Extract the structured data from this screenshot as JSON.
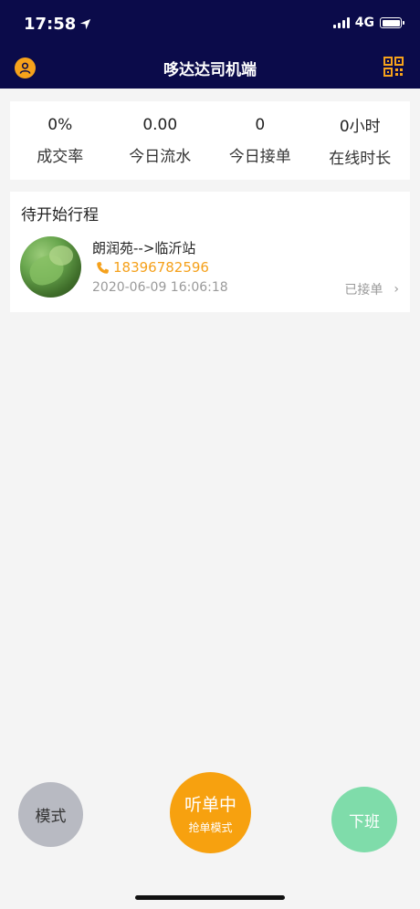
{
  "status_bar": {
    "time": "17:58",
    "network": "4G"
  },
  "header": {
    "title": "哆达达司机端",
    "profile_icon": "user-icon",
    "qr_icon": "qr-code-icon",
    "background_color": "#0b0b4a",
    "accent_color": "#f6a21b"
  },
  "stats": [
    {
      "value": "0%",
      "label": "成交率"
    },
    {
      "value": "0.00",
      "label": "今日流水"
    },
    {
      "value": "0",
      "label": "今日接单"
    },
    {
      "value": "0小时",
      "label": "在线时长"
    }
  ],
  "trip": {
    "heading": "待开始行程",
    "route": "朗润苑-->临沂站",
    "phone": "18396782596",
    "datetime": "2020-06-09 16:06:18",
    "status": "已接单",
    "chevron": "›"
  },
  "actions": {
    "mode_label": "模式",
    "listen_label": "听单中",
    "listen_sub_label": "抢单模式",
    "offwork_label": "下班"
  }
}
